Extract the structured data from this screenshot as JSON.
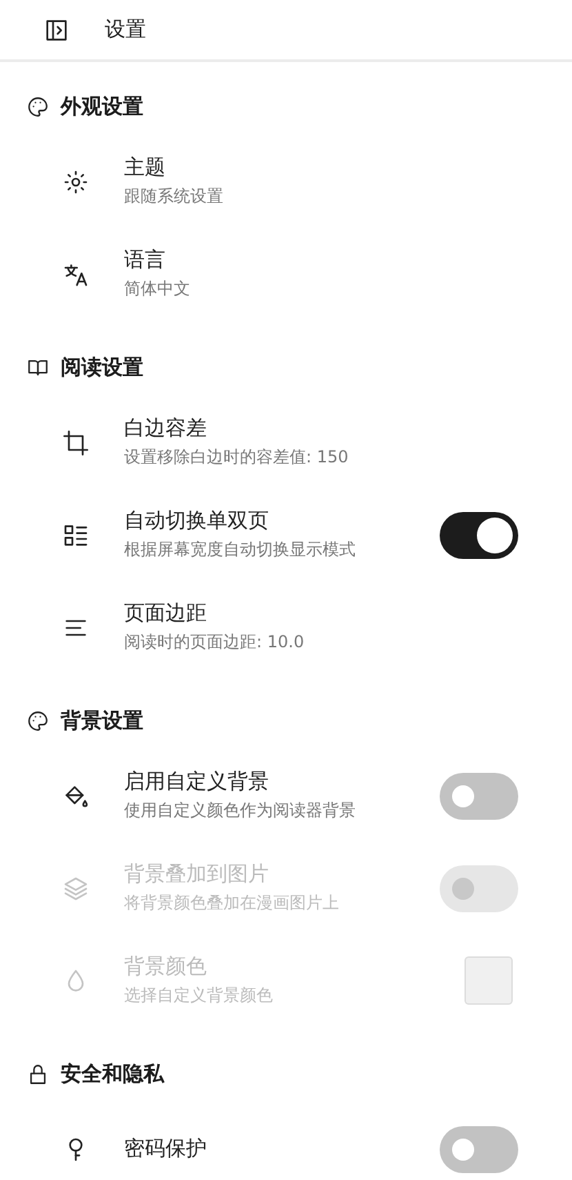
{
  "top_bar": {
    "title": "设置"
  },
  "sections": [
    {
      "title": "外观设置",
      "items": [
        {
          "kind": "none",
          "title": "主题",
          "subtitle": "跟随系统设置",
          "disabled": false
        },
        {
          "kind": "none",
          "title": "语言",
          "subtitle": "简体中文",
          "disabled": false
        }
      ]
    },
    {
      "title": "阅读设置",
      "items": [
        {
          "kind": "none",
          "title": "白边容差",
          "subtitle": "设置移除白边时的容差值: 150",
          "disabled": false
        },
        {
          "kind": "toggle",
          "title": "自动切换单双页",
          "subtitle": "根据屏幕宽度自动切换显示模式",
          "disabled": false,
          "on": true
        },
        {
          "kind": "none",
          "title": "页面边距",
          "subtitle": "阅读时的页面边距: 10.0",
          "disabled": false
        }
      ]
    },
    {
      "title": "背景设置",
      "items": [
        {
          "kind": "toggle",
          "title": "启用自定义背景",
          "subtitle": "使用自定义颜色作为阅读器背景",
          "disabled": false,
          "on": false
        },
        {
          "kind": "toggle",
          "title": "背景叠加到图片",
          "subtitle": "将背景颜色叠加在漫画图片上",
          "disabled": true,
          "on": false
        },
        {
          "kind": "color",
          "title": "背景颜色",
          "subtitle": "选择自定义背景颜色",
          "disabled": true,
          "color": "#f0f0f0"
        }
      ]
    },
    {
      "title": "安全和隐私",
      "items": [
        {
          "kind": "toggle",
          "title": "密码保护",
          "disabled": false,
          "on": false
        }
      ]
    }
  ]
}
